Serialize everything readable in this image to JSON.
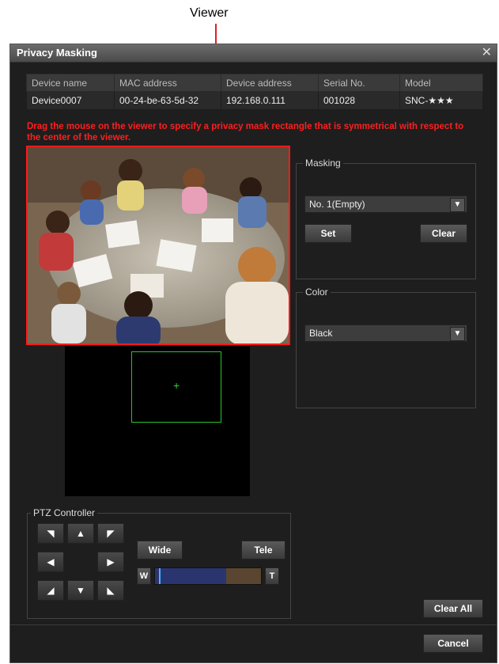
{
  "callout": {
    "label": "Viewer"
  },
  "dialog": {
    "title": "Privacy Masking",
    "close_glyph": "✕"
  },
  "device_table": {
    "headers": [
      "Device name",
      "MAC address",
      "Device address",
      "Serial No.",
      "Model"
    ],
    "row": [
      "Device0007",
      "00-24-be-63-5d-32",
      "192.168.0.111",
      "001028",
      "SNC-★★★"
    ]
  },
  "warning": "Drag the mouse on the viewer to specify a privacy mask rectangle that is symmetrical with respect to the center of the viewer.",
  "preview": {
    "crosshair": "+"
  },
  "masking": {
    "legend": "Masking",
    "selected": "No. 1(Empty)",
    "set_label": "Set",
    "clear_label": "Clear"
  },
  "color": {
    "legend": "Color",
    "selected": "Black"
  },
  "ptz": {
    "legend": "PTZ Controller",
    "wide_label": "Wide",
    "tele_label": "Tele",
    "w_label": "W",
    "t_label": "T",
    "zoom_level": 0.04,
    "arrows": {
      "up_left": "◥",
      "up": "▲",
      "up_right": "◤",
      "left": "◀",
      "right": "▶",
      "down_left": "◢",
      "down": "▼",
      "down_right": "◣"
    }
  },
  "footer": {
    "clear_all_label": "Clear All",
    "cancel_label": "Cancel"
  },
  "colors": {
    "accent_red": "#ff1e1e",
    "zoom_blue": "#2a3570",
    "zoom_tan": "#5a4630",
    "preview_green": "#27c72b"
  },
  "icons": {
    "dropdown": "chevron-down-icon",
    "close": "close-icon"
  }
}
